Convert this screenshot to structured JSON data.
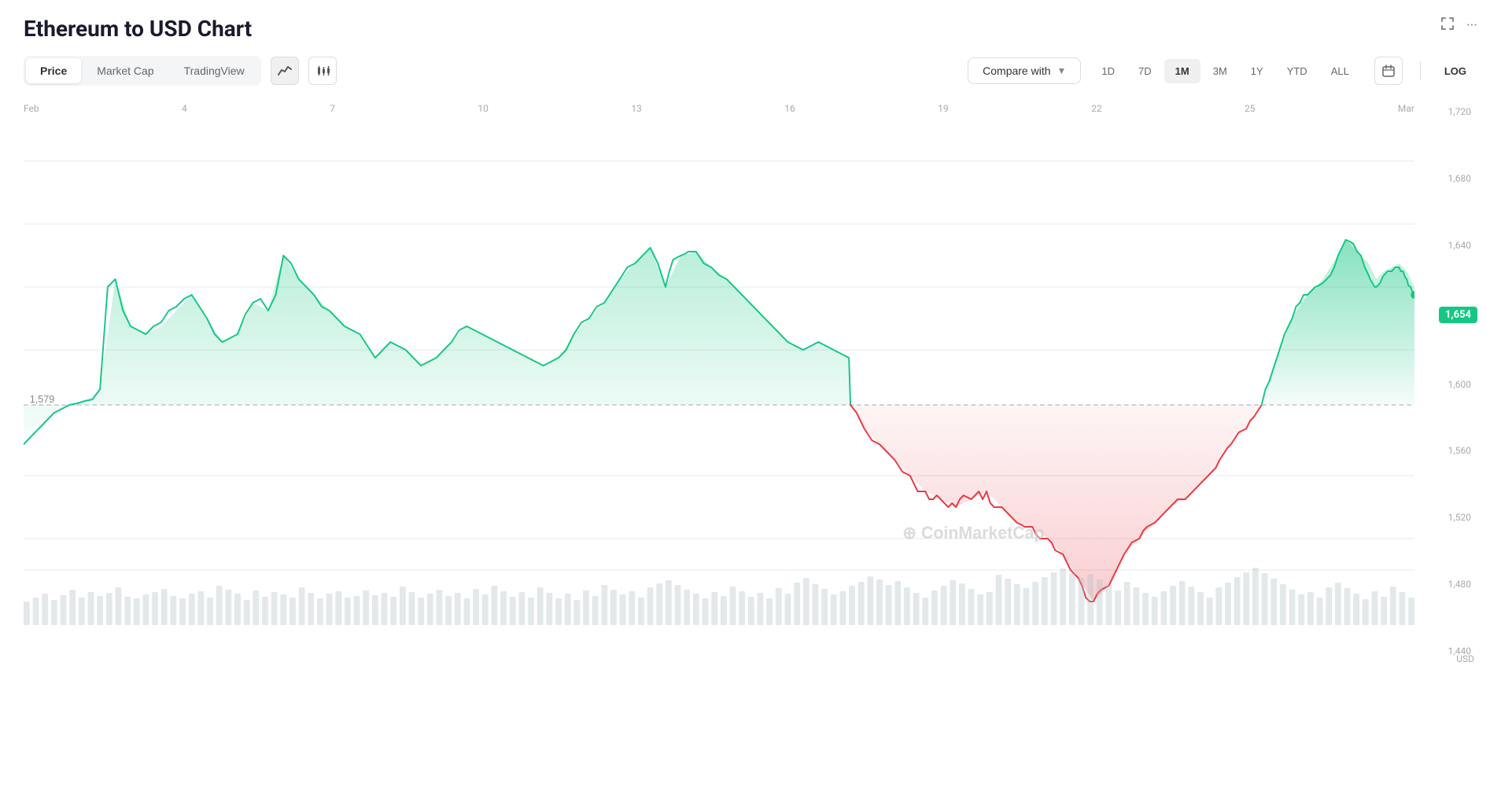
{
  "page": {
    "title": "Ethereum to USD Chart",
    "top_right_icons": {
      "expand": "⤢",
      "more": "···"
    }
  },
  "toolbar": {
    "tabs": [
      {
        "label": "Price",
        "active": true
      },
      {
        "label": "Market Cap",
        "active": false
      },
      {
        "label": "TradingView",
        "active": false
      }
    ],
    "line_icon": "line-chart-icon",
    "candle_icon": "candlestick-icon",
    "compare_with_label": "Compare with",
    "time_options": [
      {
        "label": "1D",
        "active": false
      },
      {
        "label": "7D",
        "active": false
      },
      {
        "label": "1M",
        "active": true
      },
      {
        "label": "3M",
        "active": false
      },
      {
        "label": "1Y",
        "active": false
      },
      {
        "label": "YTD",
        "active": false
      },
      {
        "label": "ALL",
        "active": false
      }
    ],
    "log_label": "LOG"
  },
  "chart": {
    "current_price": "1,654",
    "reference_price": "1,579",
    "y_labels": [
      "1,720",
      "1,680",
      "1,640",
      "1,600",
      "1,560",
      "1,520",
      "1,480",
      "1,440"
    ],
    "x_labels": [
      "Feb",
      "4",
      "7",
      "10",
      "13",
      "16",
      "19",
      "22",
      "25",
      "Mar"
    ],
    "watermark": "CoinMarketCap",
    "usd_label": "USD",
    "accent_green": "#16c784",
    "accent_red": "#ea3943"
  }
}
